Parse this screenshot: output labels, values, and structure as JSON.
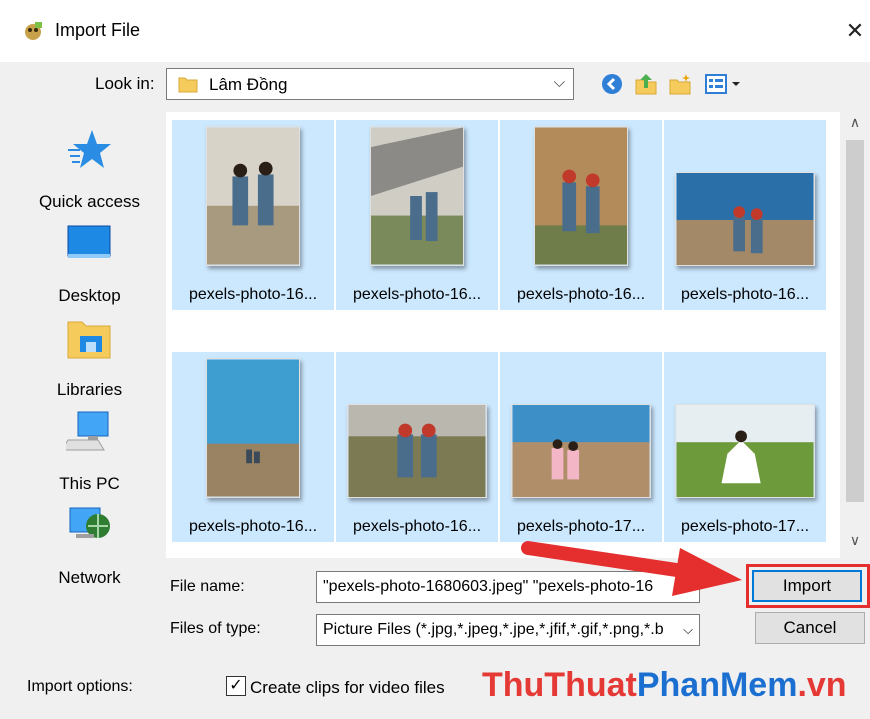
{
  "window": {
    "title": "Import File",
    "close_label": "✕"
  },
  "lookin": {
    "label": "Look in:",
    "value": "Lâm Đồng"
  },
  "places": [
    {
      "label": "Quick access",
      "icon": "star-icon"
    },
    {
      "label": "Desktop",
      "icon": "desktop-icon"
    },
    {
      "label": "Libraries",
      "icon": "libraries-icon"
    },
    {
      "label": "This PC",
      "icon": "computer-icon"
    },
    {
      "label": "Network",
      "icon": "network-icon"
    }
  ],
  "files": [
    {
      "name": "pexels-photo-16..."
    },
    {
      "name": "pexels-photo-16..."
    },
    {
      "name": "pexels-photo-16..."
    },
    {
      "name": "pexels-photo-16..."
    },
    {
      "name": "pexels-photo-16..."
    },
    {
      "name": "pexels-photo-16..."
    },
    {
      "name": "pexels-photo-17..."
    },
    {
      "name": "pexels-photo-17..."
    }
  ],
  "filename": {
    "label": "File name:",
    "value": "\"pexels-photo-1680603.jpeg\" \"pexels-photo-16"
  },
  "filetype": {
    "label": "Files of type:",
    "value": "Picture Files (*.jpg,*.jpeg,*.jpe,*.jfif,*.gif,*.png,*.b"
  },
  "buttons": {
    "import": "Import",
    "cancel": "Cancel"
  },
  "import_options": {
    "label": "Import options:",
    "create_clips_label": "Create clips for video files",
    "create_clips_checked": true,
    "check_mark": "✓"
  },
  "watermark": {
    "part1": "ThuThuat",
    "part2": "PhanMem",
    "part3": ".vn"
  },
  "colors": {
    "selection": "#cce8ff",
    "dialog_bg": "#f0f0f0",
    "highlight_red": "#e52e2e",
    "accent_blue": "#0078d7"
  }
}
